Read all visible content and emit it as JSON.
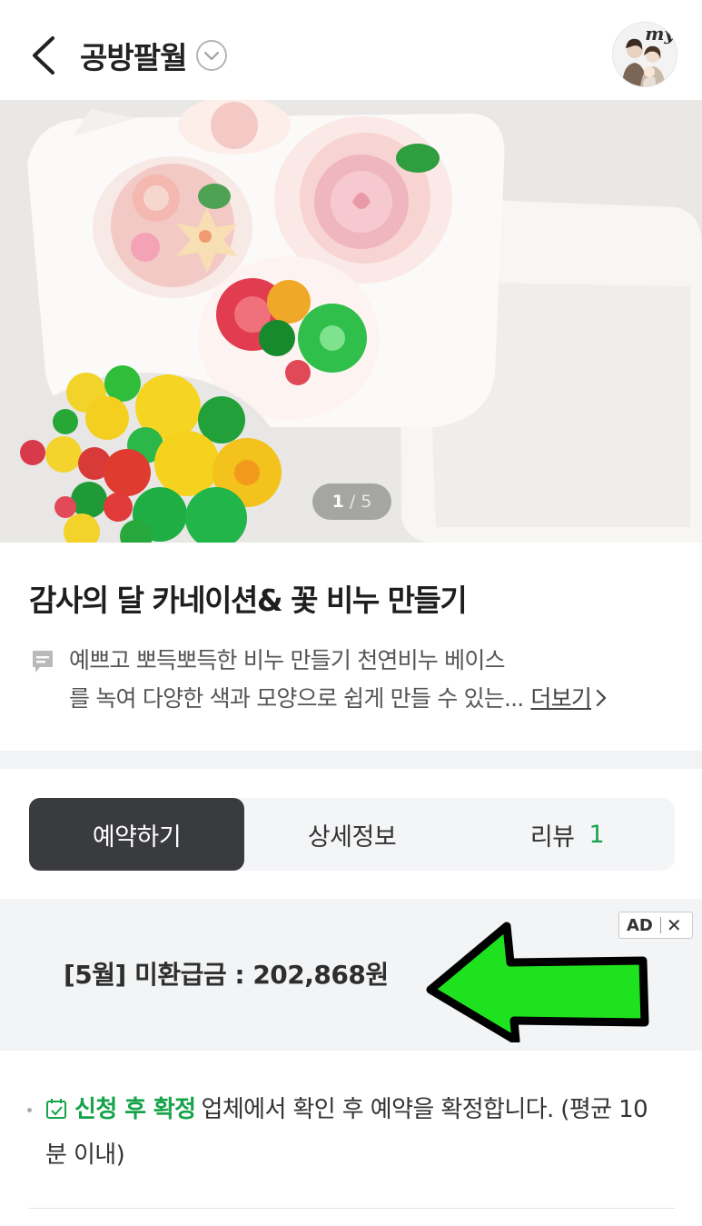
{
  "header": {
    "store_name": "공방팔월",
    "back_icon": "chevron-left-icon",
    "dropdown_icon": "circle-chevron-down-icon",
    "avatar_text": "my"
  },
  "hero": {
    "pager_current": "1",
    "pager_separator": "/",
    "pager_total": "5"
  },
  "product": {
    "title": "감사의 달 카네이션& 꽃 비누 만들기",
    "desc_icon": "comment-icon",
    "desc_line1": "예쁘고 뽀득뽀득한 비누 만들기 천연비누 베이스",
    "desc_line2": "를 녹여 다양한 색과 모양으로 쉽게 만들 수 있는...",
    "more_label": "더보기"
  },
  "tabs": [
    {
      "label": "예약하기",
      "active": true
    },
    {
      "label": "상세정보",
      "active": false
    },
    {
      "label": "리뷰",
      "count": "1",
      "active": false
    }
  ],
  "ad": {
    "text": "[5월] 미환급금 : 202,868원",
    "badge_label": "AD",
    "close_label": "✕",
    "arrow_color": "#1fe21f"
  },
  "notice": {
    "strong": "신청 후 확정",
    "text": "업체에서 확인 후 예약을 확정합니다. (평균 10분 이내)"
  },
  "colors": {
    "accent_green": "#16a34a",
    "tab_active_bg": "#3a3b3f"
  }
}
